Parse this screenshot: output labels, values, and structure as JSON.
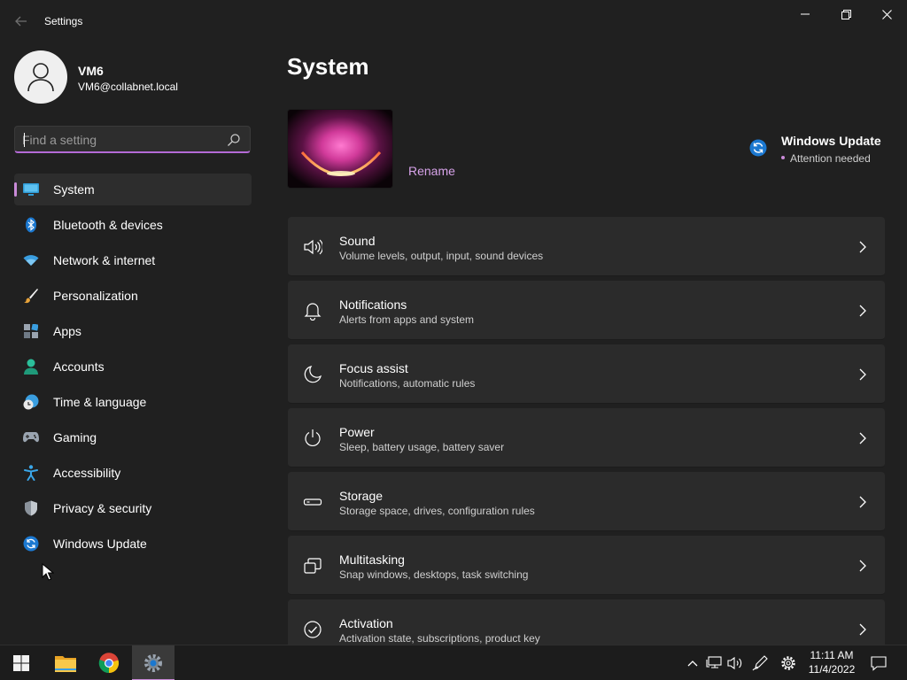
{
  "window": {
    "title": "Settings"
  },
  "user": {
    "name": "VM6",
    "email": "VM6@collabnet.local"
  },
  "search": {
    "placeholder": "Find a setting",
    "value": ""
  },
  "sidebar": {
    "items": [
      {
        "label": "System",
        "icon": "system-icon",
        "active": true
      },
      {
        "label": "Bluetooth & devices",
        "icon": "bluetooth-icon"
      },
      {
        "label": "Network & internet",
        "icon": "wifi-icon"
      },
      {
        "label": "Personalization",
        "icon": "brush-icon"
      },
      {
        "label": "Apps",
        "icon": "apps-icon"
      },
      {
        "label": "Accounts",
        "icon": "accounts-icon"
      },
      {
        "label": "Time & language",
        "icon": "clock-globe-icon"
      },
      {
        "label": "Gaming",
        "icon": "gamepad-icon"
      },
      {
        "label": "Accessibility",
        "icon": "accessibility-icon"
      },
      {
        "label": "Privacy & security",
        "icon": "shield-icon"
      },
      {
        "label": "Windows Update",
        "icon": "update-icon"
      }
    ]
  },
  "main": {
    "title": "System",
    "rename_label": "Rename",
    "windows_update": {
      "title": "Windows Update",
      "status": "Attention needed"
    },
    "cards": [
      {
        "title": "Sound",
        "desc": "Volume levels, output, input, sound devices",
        "icon": "speaker-icon"
      },
      {
        "title": "Notifications",
        "desc": "Alerts from apps and system",
        "icon": "bell-icon"
      },
      {
        "title": "Focus assist",
        "desc": "Notifications, automatic rules",
        "icon": "moon-icon"
      },
      {
        "title": "Power",
        "desc": "Sleep, battery usage, battery saver",
        "icon": "power-icon"
      },
      {
        "title": "Storage",
        "desc": "Storage space, drives, configuration rules",
        "icon": "storage-icon"
      },
      {
        "title": "Multitasking",
        "desc": "Snap windows, desktops, task switching",
        "icon": "multitasking-icon"
      },
      {
        "title": "Activation",
        "desc": "Activation state, subscriptions, product key",
        "icon": "check-circle-icon"
      }
    ]
  },
  "taskbar": {
    "apps": [
      "start-icon",
      "file-explorer-icon",
      "chrome-icon",
      "settings-icon"
    ],
    "tray": [
      "chevron-up-icon",
      "network-icon",
      "volume-icon",
      "pen-icon",
      "gear-icon"
    ],
    "time": "11:11 AM",
    "date": "11/4/2022"
  },
  "colors": {
    "accent": "#c98ad8",
    "background": "#202020",
    "card": "#2b2b2b"
  }
}
